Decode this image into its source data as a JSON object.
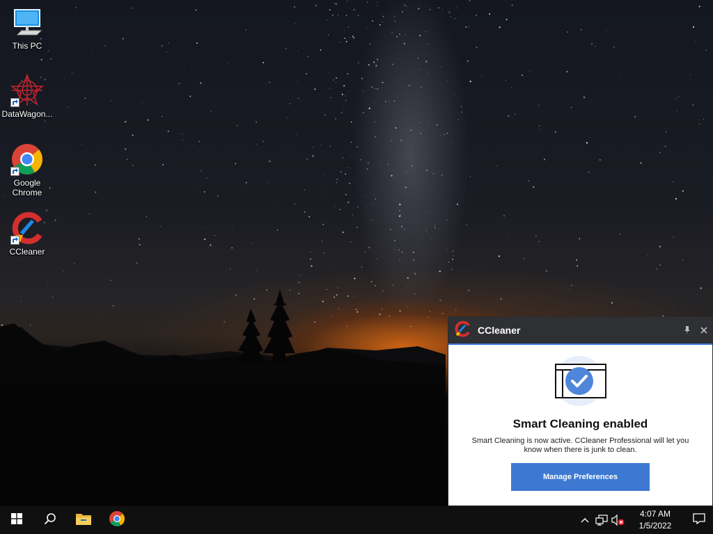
{
  "desktop": {
    "icons": [
      {
        "label": "This PC"
      },
      {
        "label": "DataWagon..."
      },
      {
        "label": "Google Chrome"
      },
      {
        "label": "CCleaner"
      }
    ]
  },
  "toast": {
    "app_name": "CCleaner",
    "heading": "Smart Cleaning enabled",
    "message": "Smart Cleaning is now active. CCleaner Professional will let you know when there is junk to clean.",
    "button_label": "Manage Preferences",
    "accent_color": "#3d79d2"
  },
  "taskbar": {
    "pinned": [
      "windows-start-icon",
      "search-icon",
      "file-explorer-icon",
      "chrome-icon"
    ],
    "tray_icons": [
      "chevron-up-icon",
      "network-icon",
      "volume-muted-icon"
    ],
    "time": "4:07 AM",
    "date": "1/5/2022"
  }
}
